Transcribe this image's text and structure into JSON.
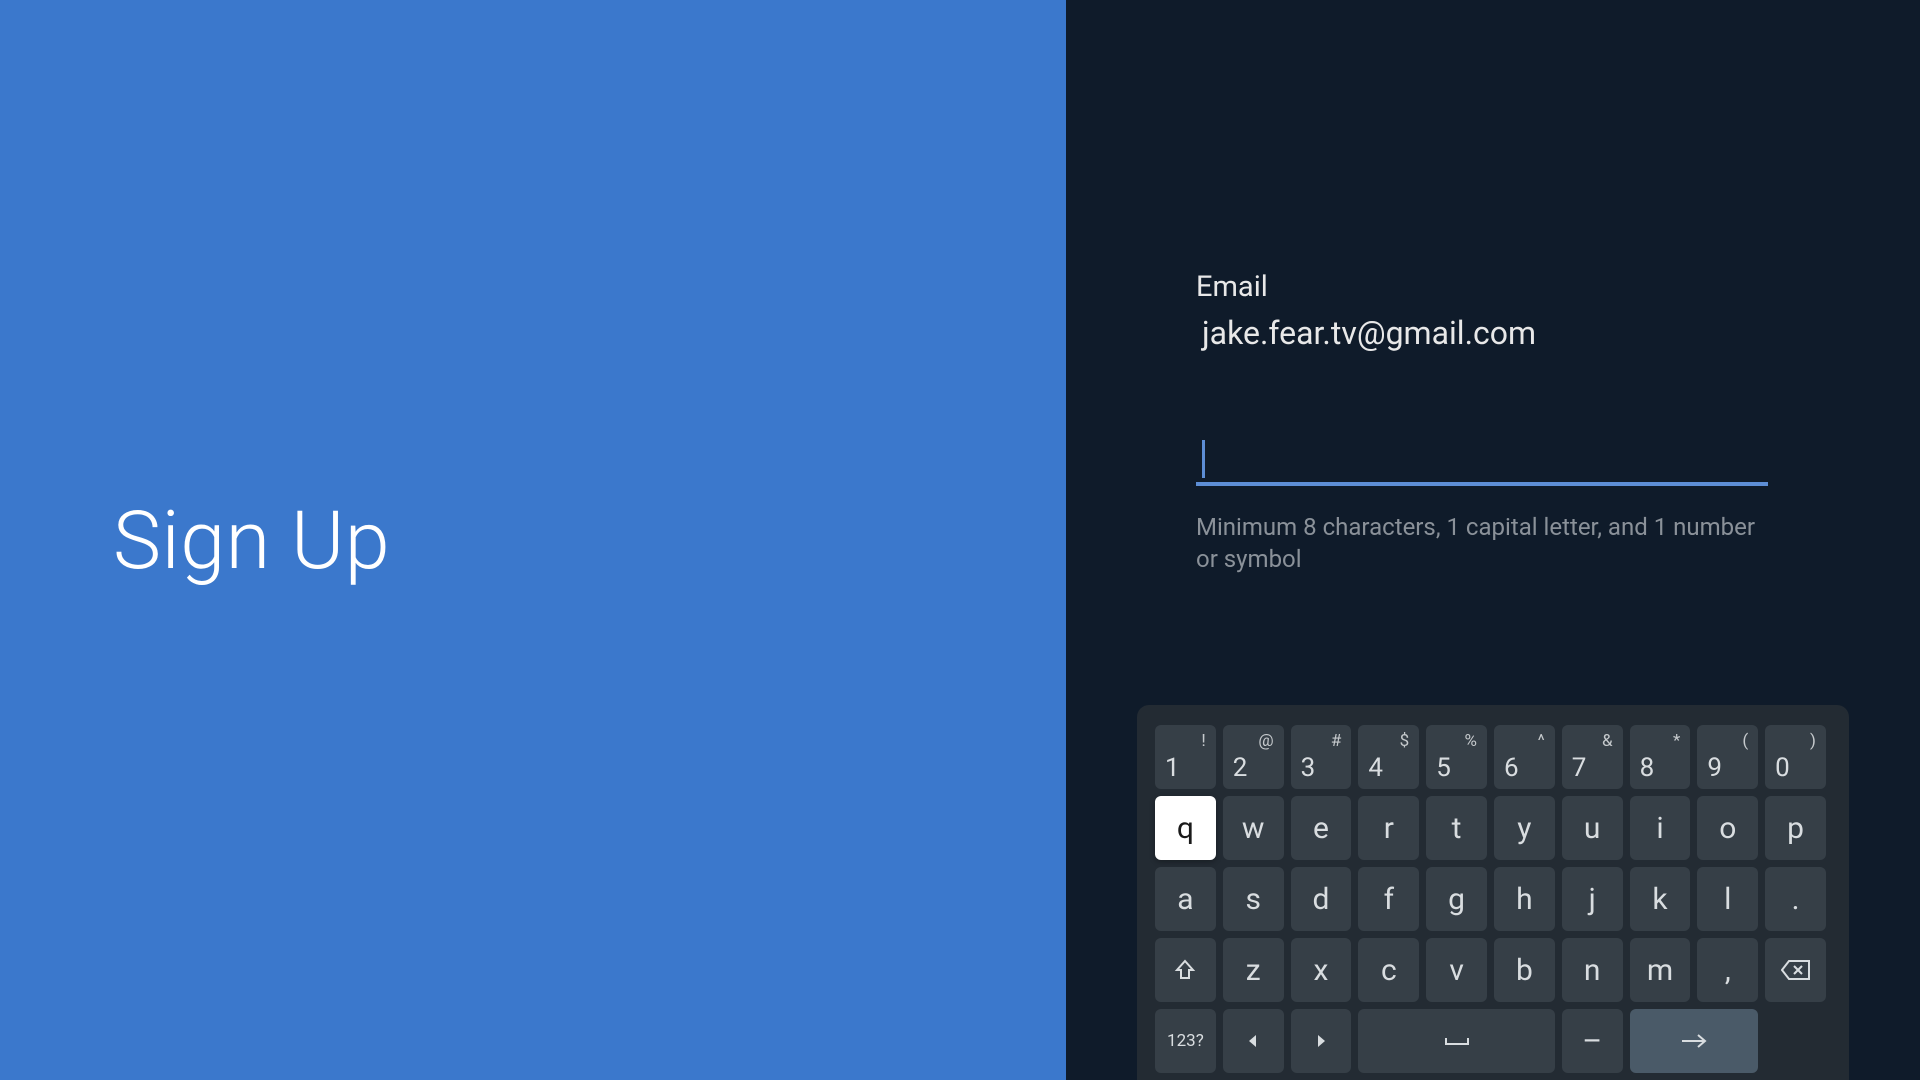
{
  "left": {
    "title": "Sign Up"
  },
  "form": {
    "email_label": "Email",
    "email_value": "jake.fear.tv@gmail.com",
    "password_value": "",
    "password_hint": "Minimum 8 characters, 1 capital letter, and 1 number or symbol"
  },
  "keyboard": {
    "row1": [
      {
        "main": "1",
        "sup": "!"
      },
      {
        "main": "2",
        "sup": "@"
      },
      {
        "main": "3",
        "sup": "#"
      },
      {
        "main": "4",
        "sup": "$"
      },
      {
        "main": "5",
        "sup": "%"
      },
      {
        "main": "6",
        "sup": "^"
      },
      {
        "main": "7",
        "sup": "&"
      },
      {
        "main": "8",
        "sup": "*"
      },
      {
        "main": "9",
        "sup": "("
      },
      {
        "main": "0",
        "sup": ")"
      }
    ],
    "row2": [
      "q",
      "w",
      "e",
      "r",
      "t",
      "y",
      "u",
      "i",
      "o",
      "p"
    ],
    "row2_highlight_index": 0,
    "row3": [
      "a",
      "s",
      "d",
      "f",
      "g",
      "h",
      "j",
      "k",
      "l",
      "."
    ],
    "row4_letters": [
      "z",
      "x",
      "c",
      "v",
      "b",
      "n",
      "m",
      ","
    ],
    "row5": {
      "mode": "123?",
      "dash": "–"
    }
  }
}
